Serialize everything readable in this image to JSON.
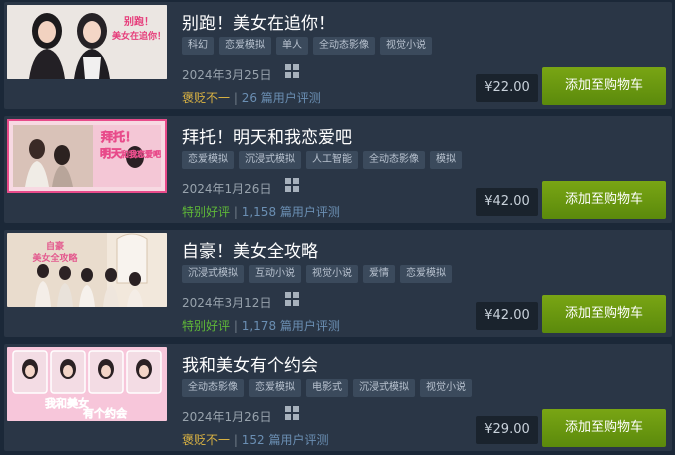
{
  "games": [
    {
      "title": "别跑！美女在追你！",
      "tags": [
        "科幻",
        "恋爱模拟",
        "单人",
        "全动态影像",
        "视觉小说"
      ],
      "release_date": "2024年3月25日",
      "platform_icon": "windows-icon",
      "review_label": "褒贬不一",
      "review_separator": "|",
      "review_count": "26 篇用户评测",
      "review_color": "#d9b243",
      "price": "¥22.00",
      "cart_label": "添加至购物车",
      "capsule_text": [
        "别跑！",
        "美女在追你！"
      ]
    },
    {
      "title": "拜托！明天和我恋爱吧",
      "tags": [
        "恋爱模拟",
        "沉浸式模拟",
        "人工智能",
        "全动态影像",
        "模拟"
      ],
      "release_date": "2024年1月26日",
      "platform_icon": "windows-icon",
      "review_label": "特别好评",
      "review_separator": "|",
      "review_count": "1,158 篇用户评测",
      "review_color": "#5fb838",
      "price": "¥42.00",
      "cart_label": "添加至购物车",
      "capsule_text": [
        "拜托！",
        "明天",
        "和我恋爱吧"
      ]
    },
    {
      "title": "自豪！美女全攻略",
      "tags": [
        "沉浸式模拟",
        "互动小说",
        "视觉小说",
        "爱情",
        "恋爱模拟"
      ],
      "release_date": "2024年3月12日",
      "platform_icon": "windows-icon",
      "review_label": "特别好评",
      "review_separator": "|",
      "review_count": "1,178 篇用户评测",
      "review_color": "#5fb838",
      "price": "¥42.00",
      "cart_label": "添加至购物车",
      "capsule_text": [
        "自豪",
        "美女全攻略"
      ]
    },
    {
      "title": "我和美女有个约会",
      "tags": [
        "全动态影像",
        "恋爱模拟",
        "电影式",
        "沉浸式模拟",
        "视觉小说"
      ],
      "release_date": "2024年1月26日",
      "platform_icon": "windows-icon",
      "review_label": "褒贬不一",
      "review_separator": "|",
      "review_count": "152 篇用户评测",
      "review_color": "#d9b243",
      "price": "¥29.00",
      "cart_label": "添加至购物车",
      "capsule_text": [
        "我和美女",
        "有个约会"
      ]
    }
  ]
}
